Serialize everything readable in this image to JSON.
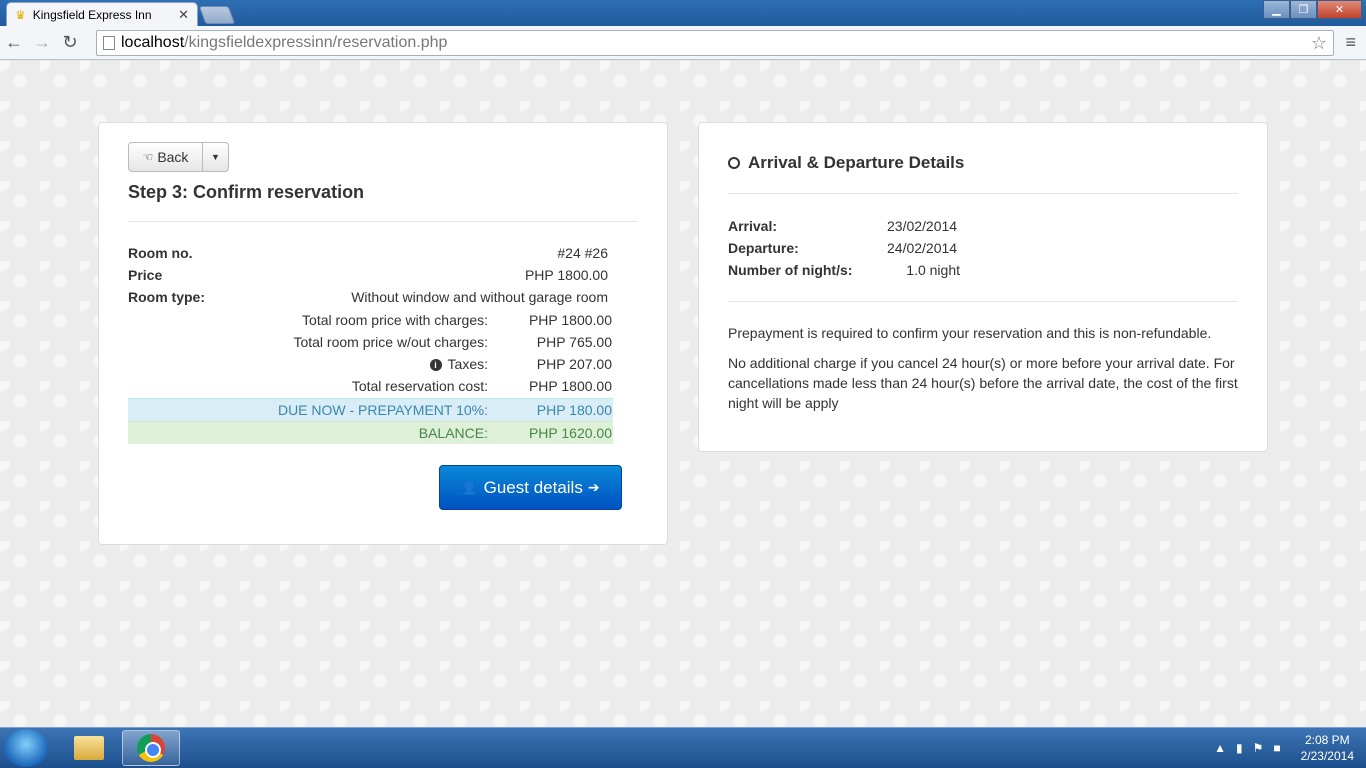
{
  "browser": {
    "tab_title": "Kingsfield Express Inn",
    "tab_close": "✕",
    "url_host": "localhost",
    "url_path": "/kingsfieldexpressinn/reservation.php"
  },
  "left_panel": {
    "back_label": "Back",
    "step_title": "Step 3: Confirm reservation",
    "details": [
      {
        "label": "Room no.",
        "value": "#24 #26"
      },
      {
        "label": "Price",
        "value": "PHP 1800.00"
      },
      {
        "label": "Room type:",
        "value": "Without window and without garage room"
      }
    ],
    "charges": [
      {
        "label": "Total room price with charges:",
        "value": "PHP 1800.00"
      },
      {
        "label": "Total room price w/out charges:",
        "value": "PHP 765.00"
      },
      {
        "label": "Taxes:",
        "value": "PHP 207.00"
      },
      {
        "label": "Total reservation cost:",
        "value": "PHP 1800.00"
      },
      {
        "label": "DUE NOW - PREPAYMENT 10%:",
        "value": "PHP 180.00"
      },
      {
        "label": "BALANCE:",
        "value": "PHP 1620.00"
      }
    ],
    "guest_button": "Guest details"
  },
  "right_panel": {
    "title": "Arrival & Departure Details",
    "rows": [
      {
        "label": "Arrival:",
        "value": "23/02/2014"
      },
      {
        "label": "Departure:",
        "value": "24/02/2014"
      },
      {
        "label": "Number of night/s:",
        "value": "1.0 night"
      }
    ],
    "policy_1": "Prepayment is required to confirm your reservation and this is non-refundable.",
    "policy_2": "No additional charge if you cancel 24 hour(s) or more before your arrival date. For cancellations made less than 24 hour(s) before the arrival date, the cost of the first night will be apply"
  },
  "taskbar": {
    "time": "2:08 PM",
    "date": "2/23/2014"
  }
}
